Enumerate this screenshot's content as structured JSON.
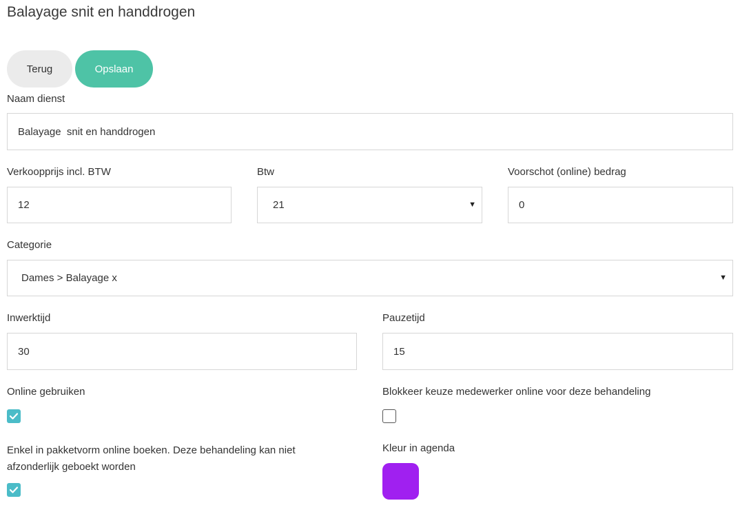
{
  "page": {
    "title": "Balayage snit en handdrogen"
  },
  "actions": {
    "back_label": "Terug",
    "save_label": "Opslaan"
  },
  "form": {
    "name": {
      "label": "Naam dienst",
      "value": "Balayage  snit en handdrogen"
    },
    "price": {
      "label": "Verkoopprijs incl. BTW",
      "value": "12"
    },
    "vat": {
      "label": "Btw",
      "value": "21"
    },
    "deposit": {
      "label": "Voorschot (online) bedrag",
      "value": "0"
    },
    "category": {
      "label": "Categorie",
      "value": "Dames > Balayage x"
    },
    "work_time": {
      "label": "Inwerktijd",
      "value": "30"
    },
    "pause_time": {
      "label": "Pauzetijd",
      "value": "15"
    },
    "online_use": {
      "label": "Online gebruiken",
      "checked": true
    },
    "block_employee": {
      "label": "Blokkeer keuze medewerker online voor deze behandeling",
      "checked": false
    },
    "package_only": {
      "label_line1": "Enkel in pakketvorm online boeken. Deze behandeling kan niet",
      "label_line2": "afzonderlijk geboekt worden",
      "checked": true
    },
    "agenda_color": {
      "label": "Kleur in agenda",
      "color": "#a020f0"
    }
  },
  "colors": {
    "accent": "#4ec3a6",
    "checkbox": "#4bbcc8",
    "back_button": "#ebebeb"
  },
  "icons": {
    "select_caret": "caret-down-icon",
    "check": "check-icon"
  }
}
